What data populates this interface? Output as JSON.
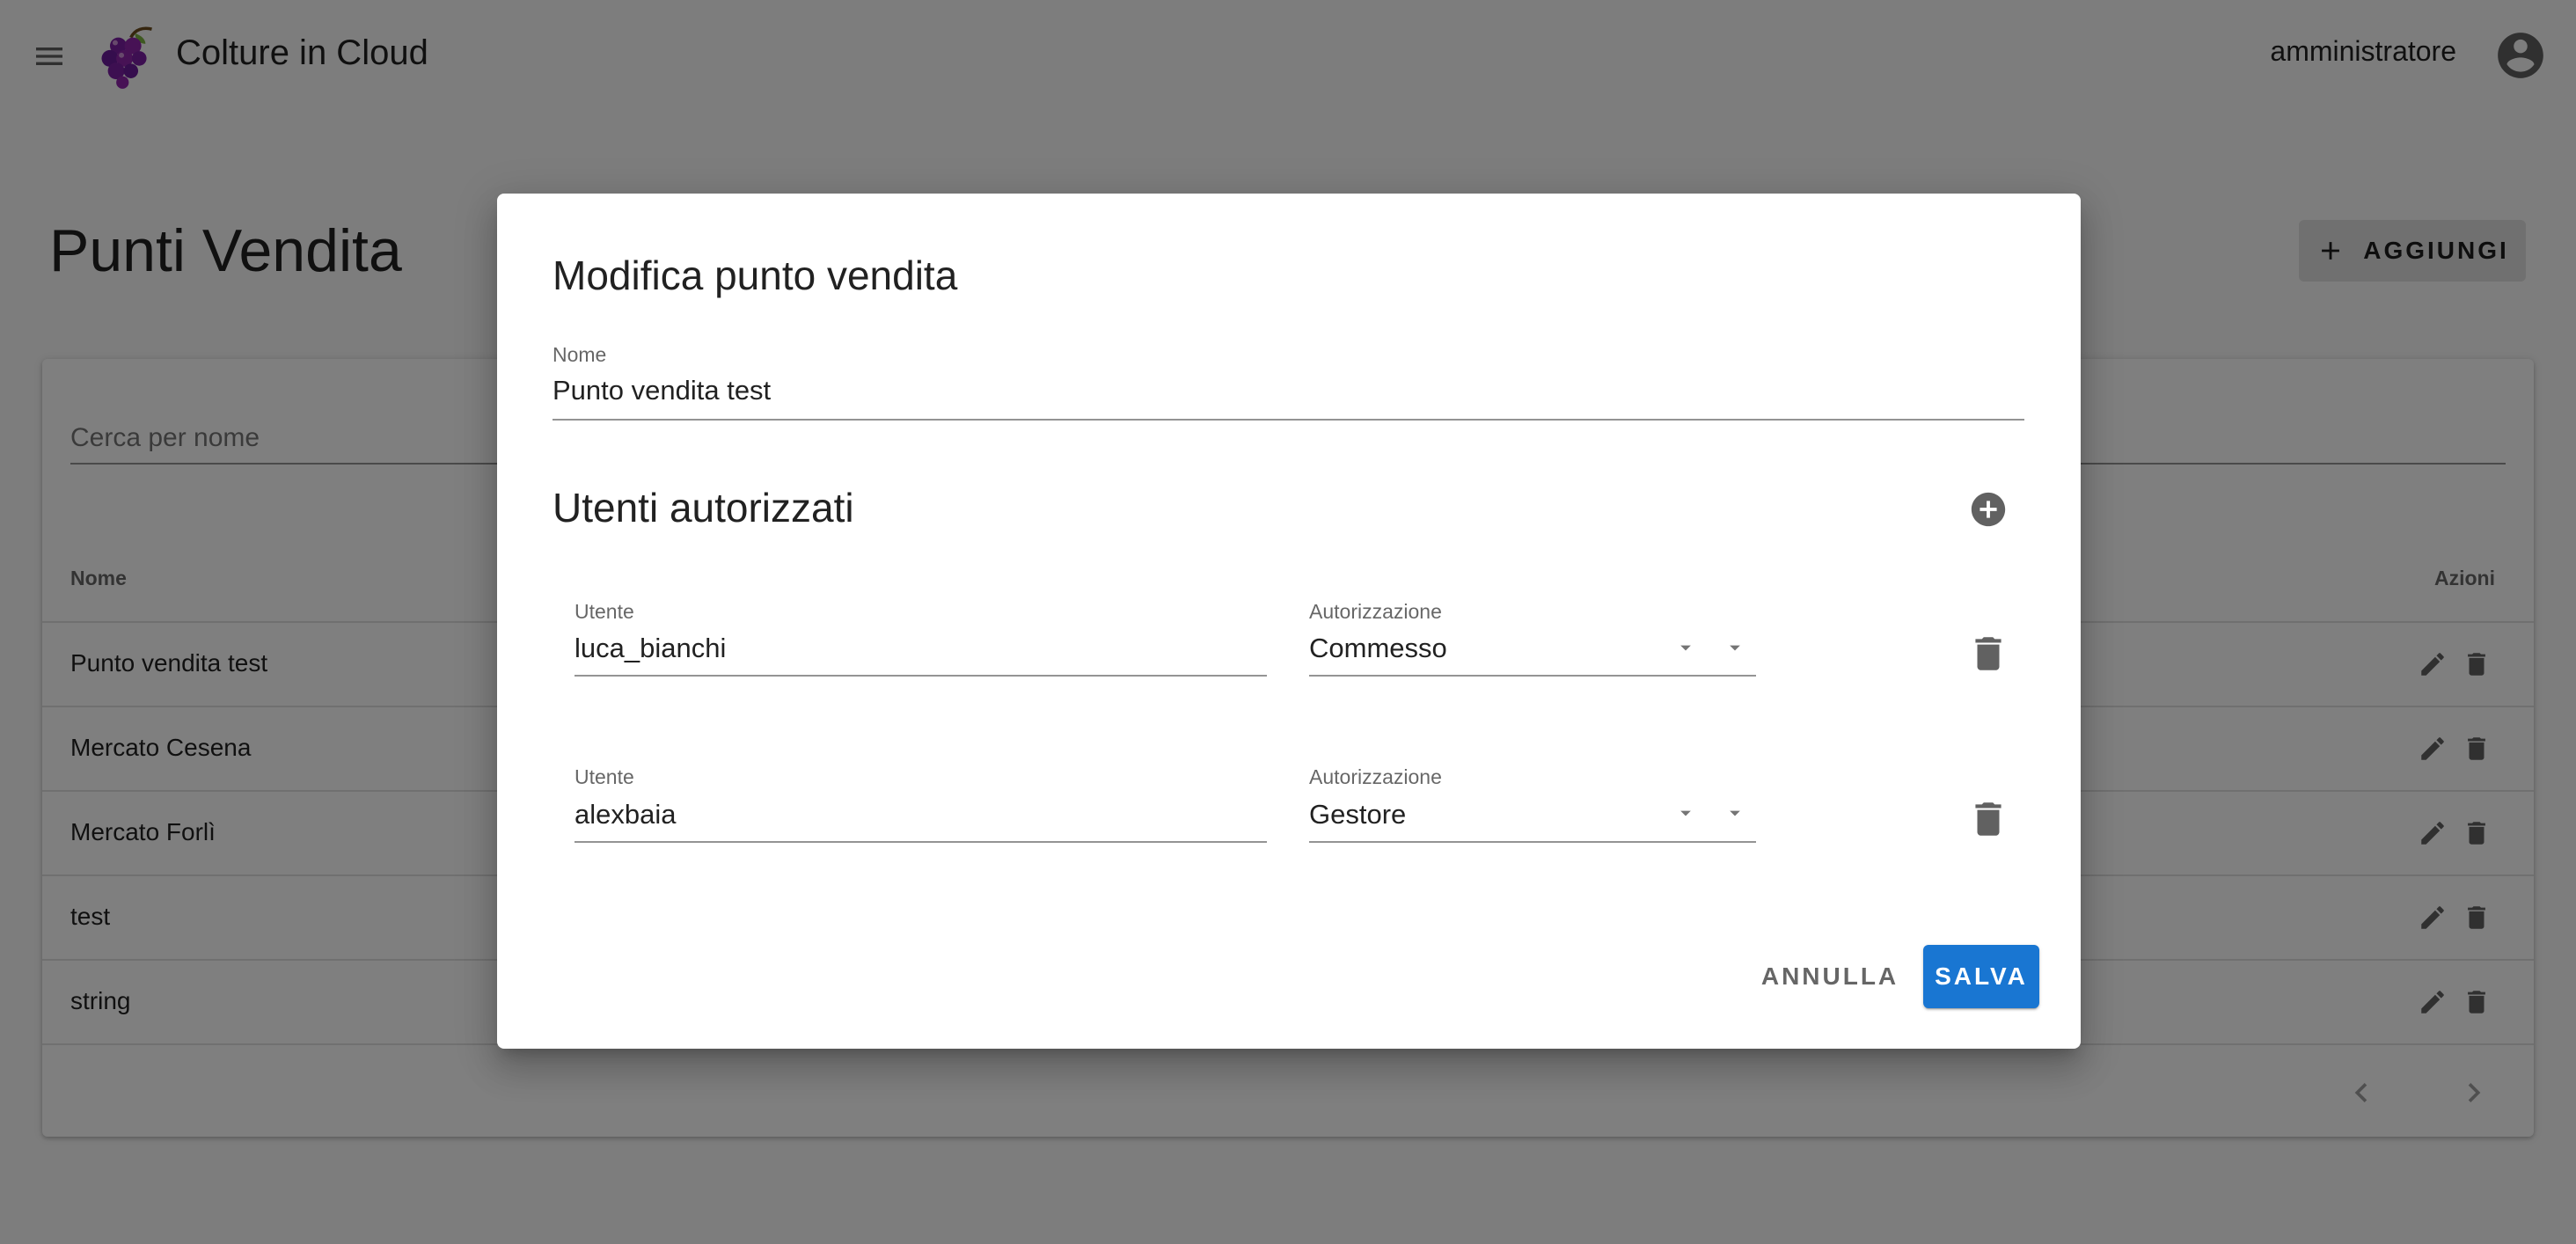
{
  "app": {
    "title": "Colture in Cloud",
    "user": "amministratore"
  },
  "page": {
    "title": "Punti Vendita",
    "add_label": "AGGIUNGI",
    "search_placeholder": "Cerca per nome"
  },
  "table": {
    "columns": {
      "name": "Nome",
      "actions": "Azioni"
    },
    "rows": [
      {
        "name": "Punto vendita test"
      },
      {
        "name": "Mercato Cesena"
      },
      {
        "name": "Mercato Forlì"
      },
      {
        "name": "test"
      },
      {
        "name": "string"
      }
    ]
  },
  "dialog": {
    "title": "Modifica punto vendita",
    "name_label": "Nome",
    "name_value": "Punto vendita test",
    "section_title": "Utenti autorizzati",
    "users": [
      {
        "user_label": "Utente",
        "user": "luca_bianchi",
        "role_label": "Autorizzazione",
        "role": "Commesso"
      },
      {
        "user_label": "Utente",
        "user": "alexbaia",
        "role_label": "Autorizzazione",
        "role": "Gestore"
      }
    ],
    "cancel_label": "ANNULLA",
    "save_label": "SALVA"
  },
  "colors": {
    "primary": "#1976d2",
    "backdrop": "rgba(0,0,0,0.5)",
    "icon": "#616161"
  },
  "icons": [
    "menu-icon",
    "grapes-logo",
    "account-circle-icon",
    "plus-icon",
    "edit-icon",
    "delete-icon",
    "chevron-left-icon",
    "chevron-right-icon",
    "add-circle-icon",
    "dropdown-arrow-icon"
  ]
}
